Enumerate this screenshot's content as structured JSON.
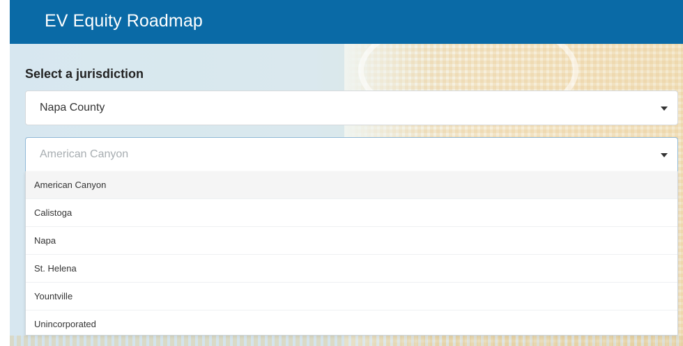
{
  "app": {
    "title": "EV Equity Roadmap",
    "header_color": "#0a6aa6"
  },
  "jurisdiction_panel": {
    "label": "Select a jurisdiction",
    "county_select": {
      "value": "Napa County"
    },
    "city_select": {
      "placeholder": "American Canyon",
      "expanded": true,
      "options": [
        "American Canyon",
        "Calistoga",
        "Napa",
        "St. Helena",
        "Yountville",
        "Unincorporated"
      ],
      "highlighted_option": "American Canyon"
    }
  },
  "icons": {
    "select_caret": "caret-down-icon"
  }
}
